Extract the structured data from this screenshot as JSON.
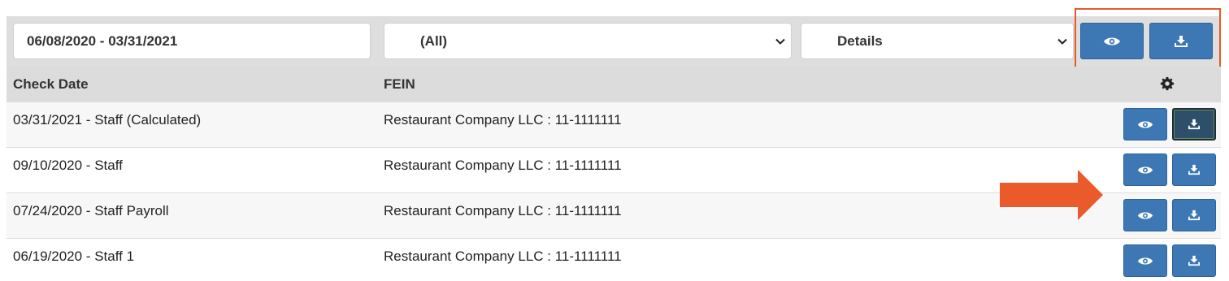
{
  "filters": {
    "date_range": "06/08/2020 - 03/31/2021",
    "fein_select": "(All)",
    "mode_select": "Details"
  },
  "table": {
    "headers": {
      "check_date": "Check Date",
      "fein": "FEIN"
    },
    "rows": [
      {
        "check_date": "03/31/2021 - Staff (Calculated)",
        "fein": "Restaurant Company LLC : 11-1111111"
      },
      {
        "check_date": "09/10/2020 - Staff",
        "fein": "Restaurant Company LLC : 11-1111111"
      },
      {
        "check_date": "07/24/2020 - Staff Payroll",
        "fein": "Restaurant Company LLC : 11-1111111"
      },
      {
        "check_date": "06/19/2020 - Staff 1",
        "fein": "Restaurant Company LLC : 11-1111111"
      }
    ]
  },
  "icons": {
    "view": "eye-icon",
    "download": "download-icon",
    "settings": "gear-icon",
    "select_arrow": "chevron-down-icon"
  },
  "colors": {
    "button": "#3d78b4",
    "active_button": "#2d4f6a",
    "annotation": "#e45a2b"
  }
}
